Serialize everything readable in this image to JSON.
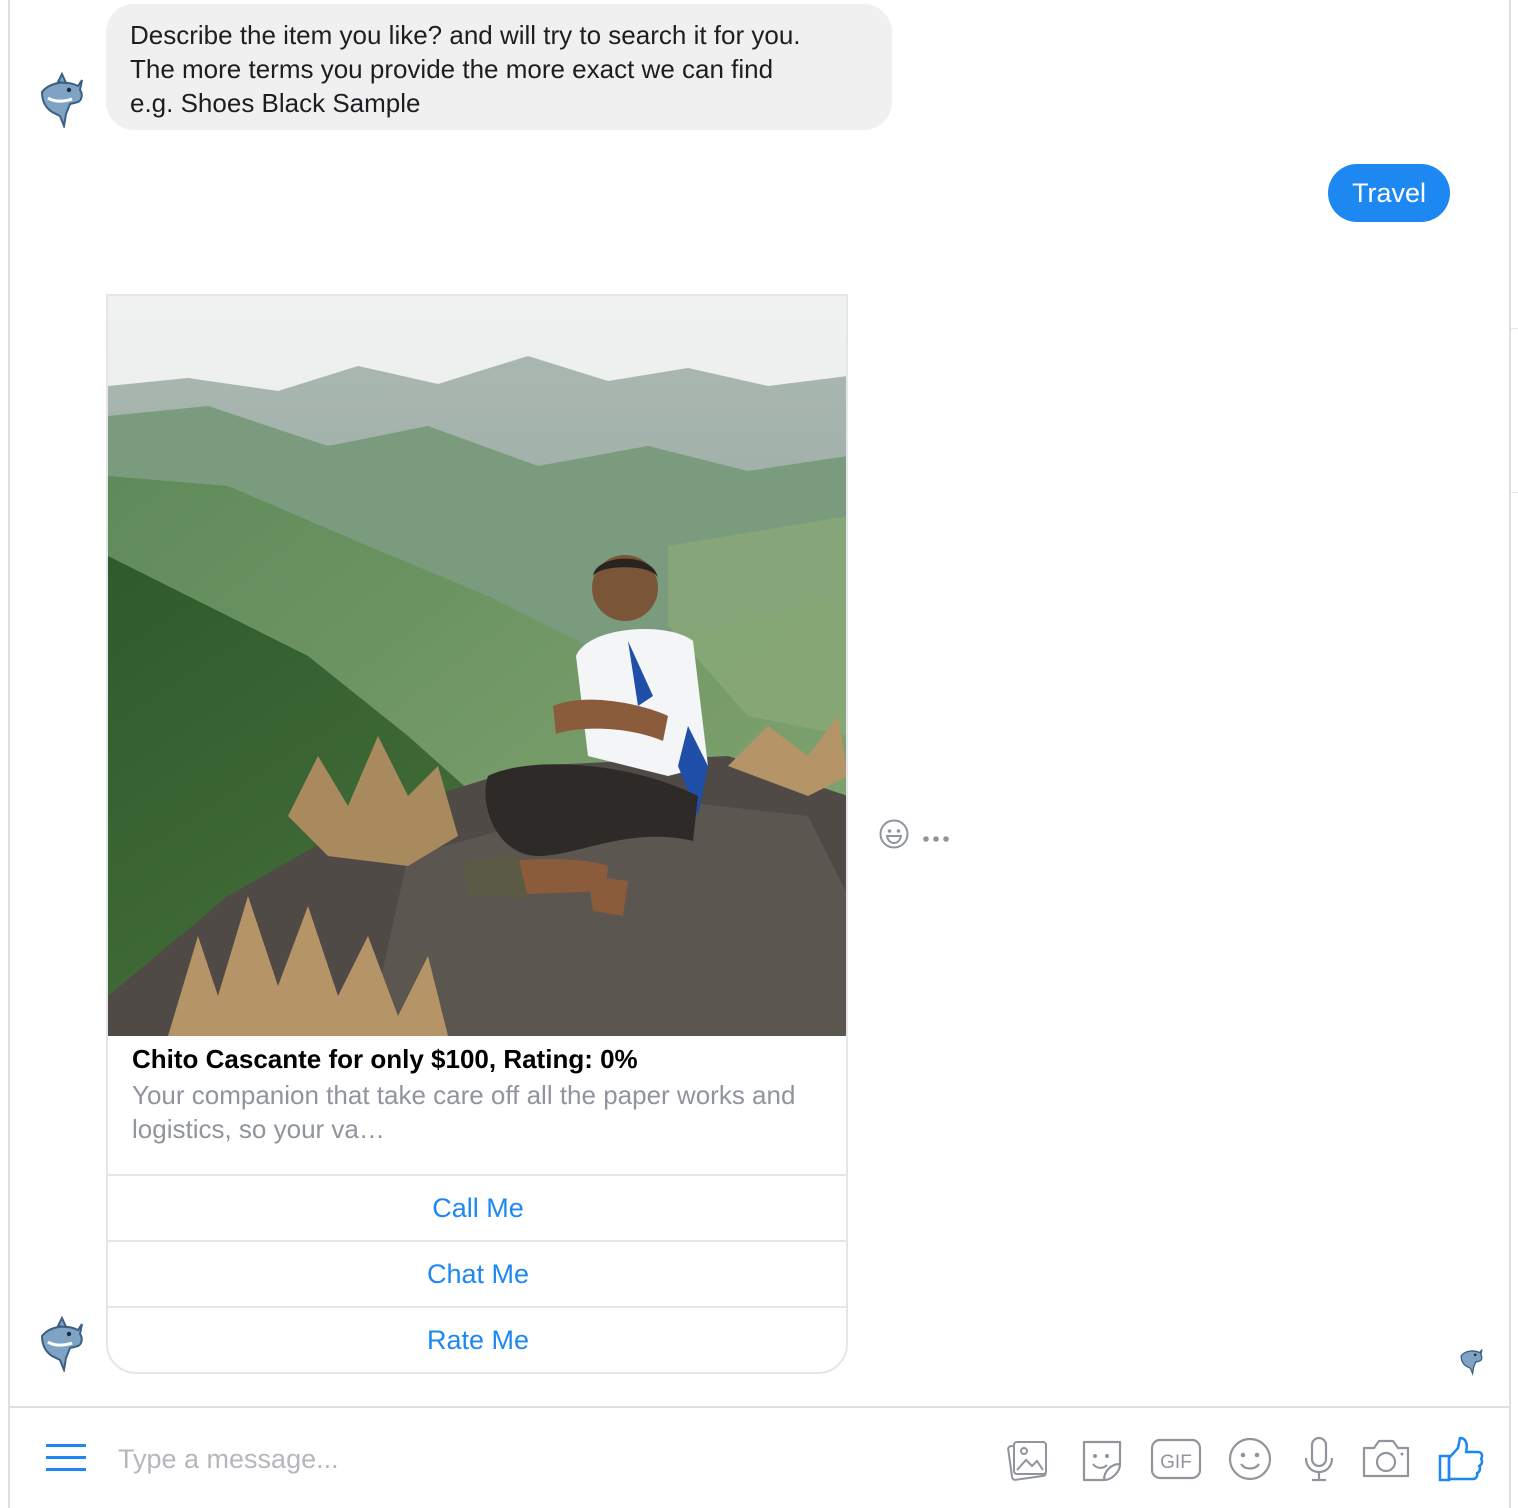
{
  "conversation": {
    "bot_message": {
      "lines": [
        "Describe the item you like? and will try to search it for you.",
        "The more terms you provide the more exact we can find",
        "e.g. Shoes Black Sample"
      ]
    },
    "user_message": "Travel",
    "card": {
      "title": "Chito Cascante for only $100, Rating: 0%",
      "subtitle": "Your companion that take care off all the paper works and logistics, so your va…",
      "buttons": [
        "Call Me",
        "Chat Me",
        "Rate Me"
      ]
    }
  },
  "composer": {
    "placeholder": "Type a message...",
    "tools": [
      "image-icon",
      "sticker-icon",
      "gif-icon",
      "emoji-icon",
      "microphone-icon",
      "camera-icon",
      "thumbs-up-icon"
    ],
    "gif_label": "GIF"
  },
  "colors": {
    "accent": "#1d88f2",
    "bot_bubble": "#f1f0f0",
    "muted_text": "#90949c"
  }
}
